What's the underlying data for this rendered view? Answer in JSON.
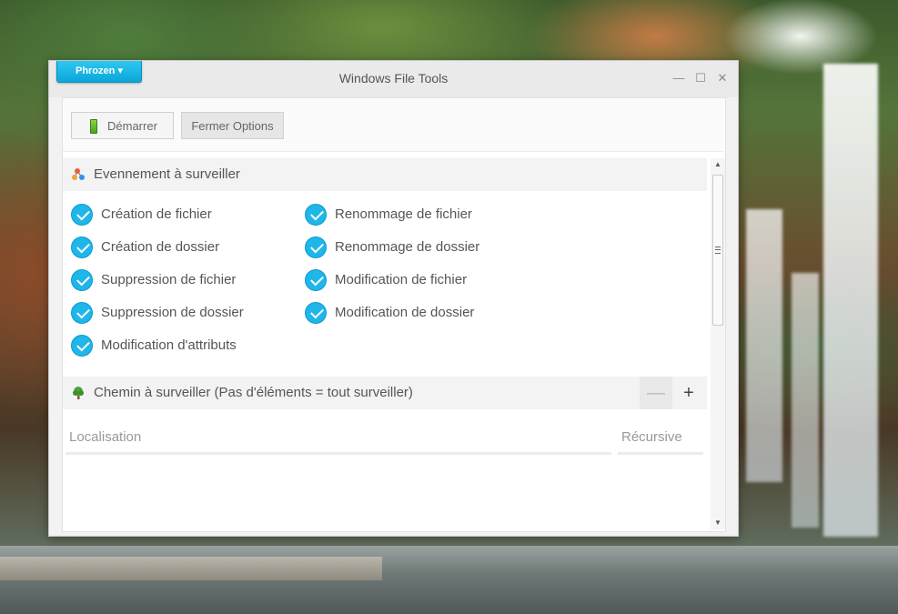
{
  "window": {
    "title": "Windows File Tools",
    "brand_label": "Phrozen ▾",
    "controls": {
      "minimize": "—",
      "maximize": "☐",
      "close": "✕"
    }
  },
  "toolbar": {
    "start_label": "Démarrer",
    "options_label": "Fermer Options"
  },
  "events_section": {
    "title": "Evennement à surveiller",
    "left_items": [
      "Création de fichier",
      "Création de dossier",
      "Suppression de fichier",
      "Suppression de dossier",
      "Modification d'attributs"
    ],
    "right_items": [
      "Renommage de fichier",
      "Renommage de dossier",
      "Modification de fichier",
      "Modification de dossier"
    ]
  },
  "path_section": {
    "title": "Chemin à surveiller (Pas d'éléments = tout surveiller)",
    "remove_label": "—",
    "add_label": "+",
    "columns": [
      "Localisation",
      "Récursive"
    ]
  },
  "colors": {
    "accent": "#1fb6ea",
    "brand": "#0aa7d8"
  },
  "icons": {
    "events": "share-nodes-icon",
    "path": "tree-icon",
    "start": "battery-icon"
  }
}
